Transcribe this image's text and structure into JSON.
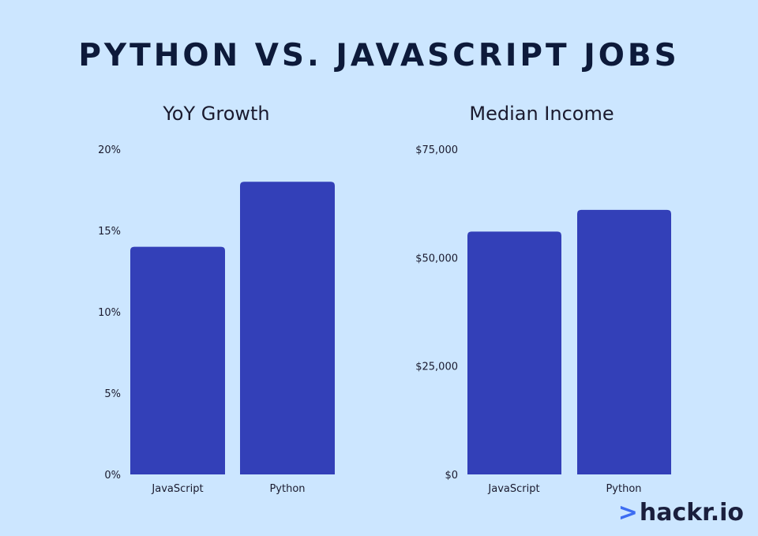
{
  "title": "PYTHON VS. JAVASCRIPT JOBS",
  "brand": {
    "chevron": ">",
    "name": "hackr.io"
  },
  "colors": {
    "background": "#cce6ff",
    "bar": "#3340b8",
    "axis": "#1a1a2e"
  },
  "chart_data": [
    {
      "type": "bar",
      "title": "YoY Growth",
      "categories": [
        "JavaScript",
        "Python"
      ],
      "values": [
        14,
        18
      ],
      "ylim": [
        0,
        20
      ],
      "yticks": [
        0,
        5,
        10,
        15,
        20
      ],
      "ytick_labels": [
        "0%",
        "5%",
        "10%",
        "15%",
        "20%"
      ],
      "grid": false
    },
    {
      "type": "bar",
      "title": "Median Income",
      "categories": [
        "JavaScript",
        "Python"
      ],
      "values": [
        56000,
        61000
      ],
      "ylim": [
        0,
        75000
      ],
      "yticks": [
        0,
        25000,
        50000,
        75000
      ],
      "ytick_labels": [
        "$0",
        "$25,000",
        "$50,000",
        "$75,000"
      ],
      "grid": false
    }
  ]
}
